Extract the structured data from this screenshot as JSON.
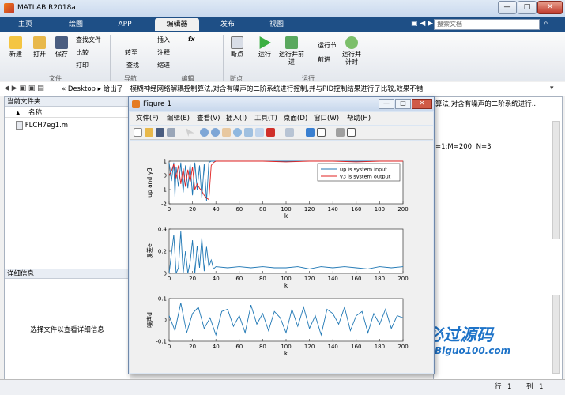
{
  "window": {
    "title": "MATLAB R2018a",
    "controls": [
      "—",
      "□",
      "✕"
    ]
  },
  "ribbon_tabs": [
    "主页",
    "绘图",
    "APP",
    "编辑器",
    "发布",
    "视图"
  ],
  "search": {
    "placeholder": "搜索文档"
  },
  "ribbon": {
    "file": {
      "new": "新建",
      "open": "打开",
      "save": "保存",
      "find_files": "查找文件",
      "compare": "比较",
      "print": "打印",
      "group": "文件"
    },
    "nav": {
      "goto": "转至",
      "find": "查找",
      "group": "导航"
    },
    "edit": {
      "insert": "插入",
      "comment": "注释",
      "indent": "缩进",
      "fx": "fx",
      "group": "编辑"
    },
    "breakpoints": {
      "label": "断点",
      "group": "断点"
    },
    "run": {
      "run": "运行",
      "run_advance": "运行并前进",
      "run_section": "运行节",
      "advance": "前进",
      "run_time": "运行并计时",
      "group": "运行"
    }
  },
  "address": {
    "path": "« Desktop ▸ 给出了一模糊神经网络解耦控制算法,对含有噪声的二阶系统进行控制,并与PID控制结果进行了比较,效果不错"
  },
  "current_folder": {
    "title": "当前文件夹",
    "col_name": "名称",
    "arrow": "▲",
    "files": [
      "FLCH7eg1.m"
    ]
  },
  "details": {
    "title": "详细信息",
    "placeholder": "选择文件以查看详细信息"
  },
  "editor": {
    "path_fragment": "算法,对含有噪声的二阶系统进行...",
    "code_fragment": "=1:M=200; N=3"
  },
  "status": {
    "row_label": "行",
    "row_value": "1",
    "col_label": "列",
    "col_value": "1"
  },
  "watermark": {
    "text": "必过源码",
    "site": "Biguo100.com"
  },
  "figure": {
    "title": "Figure 1",
    "menu": [
      "文件(F)",
      "编辑(E)",
      "查看(V)",
      "插入(I)",
      "工具(T)",
      "桌面(D)",
      "窗口(W)",
      "帮助(H)"
    ]
  },
  "chart_data": [
    {
      "type": "line",
      "xlabel": "k",
      "ylabel": "up and y3",
      "xlim": [
        0,
        200
      ],
      "ylim": [
        -2,
        1
      ],
      "xticks": [
        0,
        20,
        40,
        60,
        80,
        100,
        120,
        140,
        160,
        180,
        200
      ],
      "yticks": [
        -2,
        -1,
        0,
        1
      ],
      "legend_position": "top-right",
      "series": [
        {
          "name": "up is system input",
          "color": "#1f77b4",
          "x": [
            0,
            2,
            4,
            5,
            6,
            8,
            10,
            12,
            14,
            16,
            18,
            20,
            22,
            24,
            26,
            28,
            30,
            32,
            34,
            36,
            38,
            40,
            60,
            80,
            100,
            120,
            140,
            160,
            180,
            200
          ],
          "y": [
            0.9,
            -0.4,
            0.9,
            -1.5,
            0.6,
            -0.8,
            0.9,
            -1.2,
            0.7,
            -0.9,
            0.8,
            -1.4,
            0.9,
            -1.0,
            0.7,
            -1.6,
            0.8,
            -1.8,
            0.9,
            1.0,
            1.0,
            1.0,
            1.0,
            1.0,
            1.0,
            1.0,
            1.0,
            1.0,
            1.0,
            1.0
          ]
        },
        {
          "name": "y3 is system output",
          "color": "#e02020",
          "x": [
            0,
            2,
            4,
            6,
            8,
            10,
            12,
            14,
            16,
            18,
            20,
            22,
            24,
            26,
            28,
            30,
            32,
            34,
            36,
            38,
            40,
            60,
            80,
            100,
            120,
            140,
            160,
            180,
            200
          ],
          "y": [
            0.0,
            0.3,
            0.8,
            -0.2,
            0.7,
            -0.6,
            0.5,
            -0.8,
            0.4,
            -0.5,
            0.6,
            -1.0,
            -0.6,
            -0.9,
            -1.1,
            -1.4,
            -1.6,
            -1.7,
            0.7,
            0.9,
            1.0,
            1.0,
            1.0,
            0.95,
            1.0,
            1.0,
            0.95,
            1.0,
            1.0
          ]
        }
      ]
    },
    {
      "type": "line",
      "xlabel": "k",
      "ylabel": "误差e",
      "xlim": [
        0,
        200
      ],
      "ylim": [
        0,
        0.4
      ],
      "xticks": [
        0,
        20,
        40,
        60,
        80,
        100,
        120,
        140,
        160,
        180,
        200
      ],
      "yticks": [
        0,
        0.2,
        0.4
      ],
      "series": [
        {
          "color": "#1f77b4",
          "x": [
            0,
            4,
            6,
            8,
            10,
            12,
            14,
            16,
            18,
            20,
            22,
            24,
            26,
            28,
            30,
            32,
            34,
            36,
            38,
            40,
            50,
            60,
            70,
            80,
            90,
            100,
            110,
            120,
            130,
            140,
            150,
            160,
            170,
            180,
            190,
            200
          ],
          "y": [
            0,
            0.35,
            0,
            0.05,
            0.38,
            0,
            0.2,
            0,
            0.1,
            0.3,
            0,
            0.25,
            0.05,
            0.32,
            0.02,
            0.24,
            0.06,
            0.12,
            0.04,
            0.06,
            0.05,
            0.06,
            0.05,
            0.06,
            0.05,
            0.05,
            0.06,
            0.04,
            0.06,
            0.05,
            0.06,
            0.05,
            0.04,
            0.06,
            0.05,
            0.06
          ]
        }
      ]
    },
    {
      "type": "line",
      "xlabel": "k",
      "ylabel": "噪声d",
      "xlim": [
        0,
        200
      ],
      "ylim": [
        -0.1,
        0.1
      ],
      "xticks": [
        0,
        20,
        40,
        60,
        80,
        100,
        120,
        140,
        160,
        180,
        200
      ],
      "yticks": [
        -0.1,
        0,
        0.1
      ],
      "series": [
        {
          "color": "#1f77b4",
          "x": [
            0,
            5,
            10,
            15,
            20,
            25,
            30,
            35,
            40,
            45,
            50,
            55,
            60,
            65,
            70,
            75,
            80,
            85,
            90,
            95,
            100,
            105,
            110,
            115,
            120,
            125,
            130,
            135,
            140,
            145,
            150,
            155,
            160,
            165,
            170,
            175,
            180,
            185,
            190,
            195,
            200
          ],
          "y": [
            0.02,
            -0.05,
            0.08,
            -0.06,
            0.03,
            0.06,
            -0.04,
            0.01,
            -0.07,
            0.04,
            0.05,
            -0.03,
            0.02,
            -0.06,
            0.07,
            -0.02,
            0.03,
            -0.05,
            0.04,
            0.01,
            -0.06,
            0.05,
            -0.03,
            0.06,
            -0.04,
            0.02,
            -0.07,
            0.05,
            0.03,
            -0.02,
            0.06,
            -0.05,
            0.02,
            0.04,
            -0.06,
            0.03,
            -0.02,
            0.05,
            -0.04,
            0.02,
            0.01
          ]
        }
      ]
    }
  ]
}
